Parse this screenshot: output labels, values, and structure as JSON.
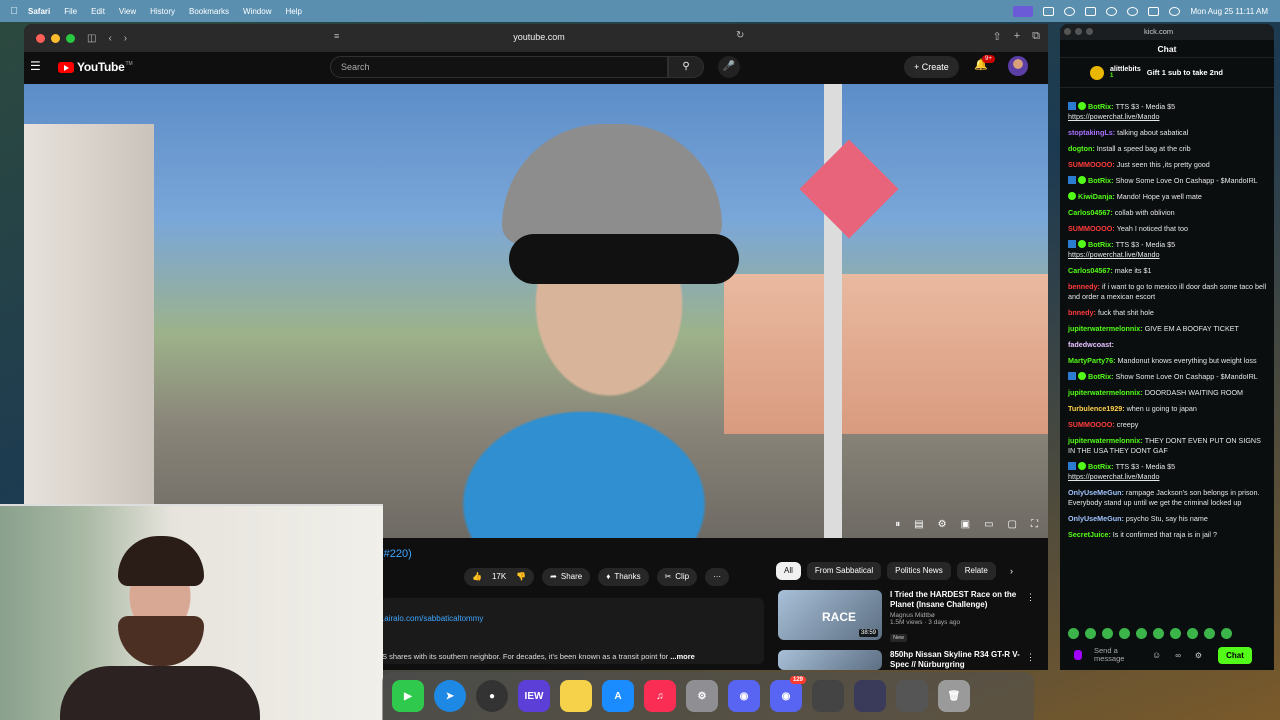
{
  "menubar": {
    "items": [
      "Safari",
      "File",
      "Edit",
      "View",
      "History",
      "Bookmarks",
      "Window",
      "Help"
    ],
    "datetime": "Mon Aug 25  11:11 AM"
  },
  "safari": {
    "url": "youtube.com"
  },
  "youtube": {
    "logo_text": "YouTube",
    "logo_tm": "TM",
    "search_placeholder": "Search",
    "create_label": "Create",
    "notification_count": "9+",
    "episode_tag": "(#220)",
    "like_count": "17K",
    "share_label": "Share",
    "thanks_label": "Thanks",
    "clip_label": "Clip",
    "more_label": "···",
    "desc_link": ".airalo.com/sabbaticaltommy",
    "desc_text": "S shares with its southern neighbor.  For decades, it's been known as a transit point for",
    "desc_more": " ...more",
    "chips": [
      "All",
      "From Sabbatical",
      "Politics News",
      "Relate"
    ],
    "recs": [
      {
        "title": "I Tried the HARDEST Race on the Planet (Insane Challenge)",
        "channel": "Magnus Midtbø",
        "meta": "1.5M views · 3 days ago",
        "badge": "New",
        "duration": "38:59",
        "thumb_text": "RACE"
      },
      {
        "title": "850hp Nissan Skyline R34 GT-R V-Spec // Nürburgring",
        "channel": "",
        "meta": "",
        "badge": "",
        "duration": "",
        "thumb_text": ""
      }
    ]
  },
  "dock": {
    "iew_label": "IEW",
    "discord_badge": "129"
  },
  "kick": {
    "url": "kick.com",
    "title": "Chat",
    "gift_user": "alittlebits",
    "gift_user_sub": "1",
    "gift_text": "Gift 1 sub to take 2nd",
    "input_placeholder": "Send a message",
    "chat_button": "Chat",
    "messages": [
      {
        "user": "BotRix",
        "color": "#53fc18",
        "text": "TTS $3 - Media $5",
        "link": "https://powerchat.live/Mando",
        "bot": true
      },
      {
        "user": "stoptakingLs",
        "color": "#a970ff",
        "text": "talking about sabatical"
      },
      {
        "user": "dogton",
        "color": "#53fc18",
        "text": "Install a speed bag at the crib"
      },
      {
        "user": "SUMMOOOO",
        "color": "#ff3b3b",
        "text": "Just seen this ,its pretty good"
      },
      {
        "user": "BotRix",
        "color": "#53fc18",
        "text": "Show Some Love On Cashapp - $MandoIRL",
        "bot": true
      },
      {
        "user": "KiwiDanja",
        "color": "#53fc18",
        "text": "Mando! Hope ya well mate",
        "ok": true
      },
      {
        "user": "Carlos04567",
        "color": "#53fc18",
        "text": "collab with oblivion"
      },
      {
        "user": "SUMMOOOO",
        "color": "#ff3b3b",
        "text": "Yeah I noticed that too"
      },
      {
        "user": "BotRix",
        "color": "#53fc18",
        "text": "TTS $3 - Media $5",
        "link": "https://powerchat.live/Mando",
        "bot": true
      },
      {
        "user": "Carlos04567",
        "color": "#53fc18",
        "text": "make its $1"
      },
      {
        "user": "bennedy",
        "color": "#ff3b3b",
        "text": "if i want to go to mexico ill door dash some taco bell and order a mexican escort"
      },
      {
        "user": "bnnedy",
        "color": "#ff3b3b",
        "text": "fuck that shit hole"
      },
      {
        "user": "jupiterwatermelonnix",
        "color": "#53fc18",
        "text": "GIVE EM A BOOFAY TICKET"
      },
      {
        "user": "fadedwcoast",
        "color": "#e7c0ff",
        "text": ""
      },
      {
        "user": "MartyParty76",
        "color": "#53fc18",
        "text": "Mandonut knows everything but weight loss"
      },
      {
        "user": "BotRix",
        "color": "#53fc18",
        "text": "Show Some Love On Cashapp - $MandoIRL",
        "bot": true
      },
      {
        "user": "jupiterwatermelonnix",
        "color": "#53fc18",
        "text": "DOORDASH WAITING ROOM"
      },
      {
        "user": "Turbulence1929",
        "color": "#ffd24a",
        "text": "when u going to japan"
      },
      {
        "user": "SUMMOOOO",
        "color": "#ff3b3b",
        "text": "creepy"
      },
      {
        "user": "jupiterwatermelonnix",
        "color": "#53fc18",
        "text": "THEY DONT EVEN PUT ON SIGNS IN THE USA THEY DONT GAF"
      },
      {
        "user": "BotRix",
        "color": "#53fc18",
        "text": "TTS $3 - Media $5",
        "link": "https://powerchat.live/Mando",
        "bot": true
      },
      {
        "user": "OnlyUseMeGun",
        "color": "#a0c4ff",
        "text": "rampage Jackson's son belongs in prison. Everybody stand up until we get the criminal locked up"
      },
      {
        "user": "OnlyUseMeGun",
        "color": "#a0c4ff",
        "text": "psycho Stu, say his name"
      },
      {
        "user": "SecretJuice",
        "color": "#53fc18",
        "text": "Is it confirmed that raja is in jail ?"
      }
    ]
  }
}
